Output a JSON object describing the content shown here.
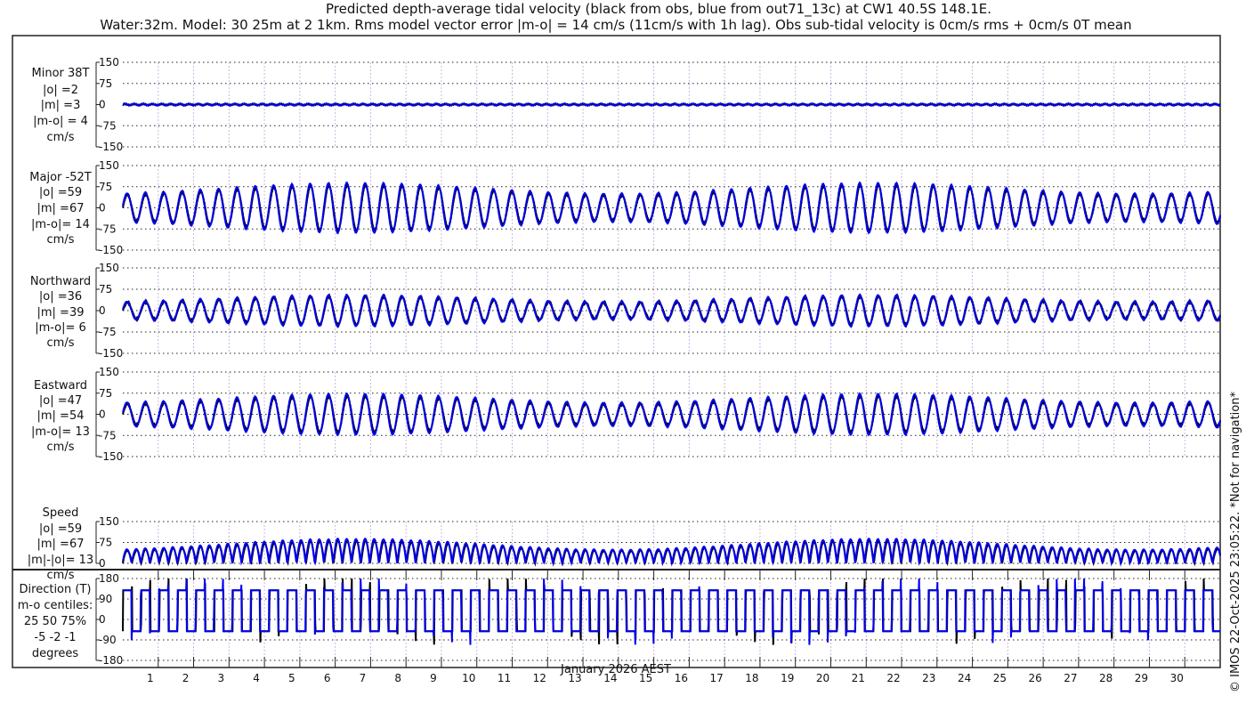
{
  "title_line1": "Predicted depth-average tidal velocity (black from obs, blue from out71_13c) at CW1 40.5S 148.1E.",
  "title_line2": "Water:32m. Model: 30 25m at 2 1km. Rms model vector error |m-o| = 14 cm/s (11cm/s with 1h lag). Obs sub-tidal velocity is 0cm/s rms + 0cm/s 0T mean",
  "footer": "© IMOS 22-Oct-2025 23:05:22. *Not for navigation*",
  "colors": {
    "obs": "#000000",
    "model": "#0000ee"
  },
  "chart_data": [
    {
      "type": "line",
      "name": "minor",
      "labels": [
        "Minor 38T",
        "|o| =2",
        "|m| =3",
        "|m-o| = 4",
        "cm/s"
      ],
      "yticks": [
        "150",
        "75",
        "0",
        "-75",
        "-150"
      ],
      "ylim": [
        -150,
        150
      ],
      "obs_amplitude": 2,
      "model_amplitude": 3
    },
    {
      "type": "line",
      "name": "major",
      "labels": [
        "Major -52T",
        "|o| =59",
        "|m| =67",
        "|m-o|= 14",
        "cm/s"
      ],
      "yticks": [
        "150",
        "75",
        "0",
        "-75",
        "-150"
      ],
      "ylim": [
        -150,
        150
      ],
      "obs_amplitude": 80,
      "model_amplitude": 88
    },
    {
      "type": "line",
      "name": "northward",
      "labels": [
        "Northward",
        "|o| =36",
        "|m| =39",
        "|m-o|= 6",
        "cm/s"
      ],
      "yticks": [
        "150",
        "75",
        "0",
        "-75",
        "-150"
      ],
      "ylim": [
        -150,
        150
      ],
      "obs_amplitude": 50,
      "model_amplitude": 54
    },
    {
      "type": "line",
      "name": "eastward",
      "labels": [
        "Eastward",
        "|o| =47",
        "|m| =54",
        "|m-o|= 13",
        "cm/s"
      ],
      "yticks": [
        "150",
        "75",
        "0",
        "-75",
        "-150"
      ],
      "ylim": [
        -150,
        150
      ],
      "obs_amplitude": 64,
      "model_amplitude": 72
    },
    {
      "type": "line",
      "name": "speed",
      "labels": [
        "Speed",
        "|o| =59",
        "|m| =67",
        "|m|-|o|= 13",
        "cm/s"
      ],
      "yticks": [
        "150",
        "75",
        "0"
      ],
      "ylim": [
        0,
        150
      ],
      "obs_amplitude": 80,
      "model_amplitude": 88
    },
    {
      "type": "line",
      "name": "direction",
      "labels": [
        "Direction (T)",
        "m-o centiles:",
        "25  50  75%",
        "-5 -2 -1",
        "degrees"
      ],
      "yticks": [
        "180",
        "90",
        "0",
        "-90",
        "-180"
      ],
      "ylim": [
        -180,
        180
      ],
      "flood_deg": 128,
      "ebb_deg": -52
    }
  ],
  "x_axis": {
    "label": "January 2026 AEST",
    "ticks": [
      "1",
      "2",
      "3",
      "4",
      "5",
      "6",
      "7",
      "8",
      "9",
      "10",
      "11",
      "12",
      "13",
      "14",
      "15",
      "16",
      "17",
      "18",
      "19",
      "20",
      "21",
      "22",
      "23",
      "24",
      "25",
      "26",
      "27",
      "28",
      "29",
      "30"
    ],
    "xlim_days": [
      0,
      31
    ],
    "tidal_period_hours": 12.42,
    "spring_neap_days": 14.77
  }
}
